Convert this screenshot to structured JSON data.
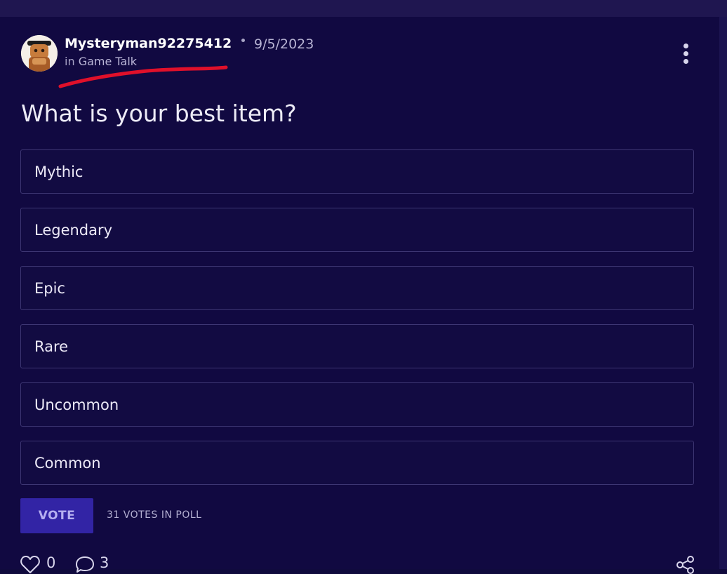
{
  "post": {
    "author": "Mysteryman92275412",
    "date": "9/5/2023",
    "category_prefix": "in",
    "category": "Game Talk",
    "question": "What is your best item?"
  },
  "poll": {
    "options": [
      "Mythic",
      "Legendary",
      "Epic",
      "Rare",
      "Uncommon",
      "Common"
    ],
    "vote_label": "VOTE",
    "vote_count_text": "31 VOTES IN POLL"
  },
  "footer": {
    "likes": "0",
    "comments": "3"
  },
  "colors": {
    "background": "#110941",
    "vote_button": "#3224a5",
    "annotation_stroke": "#e0102a"
  },
  "icons": [
    "avatar",
    "more-vertical-icon",
    "heart-icon",
    "comment-icon",
    "share-icon"
  ]
}
